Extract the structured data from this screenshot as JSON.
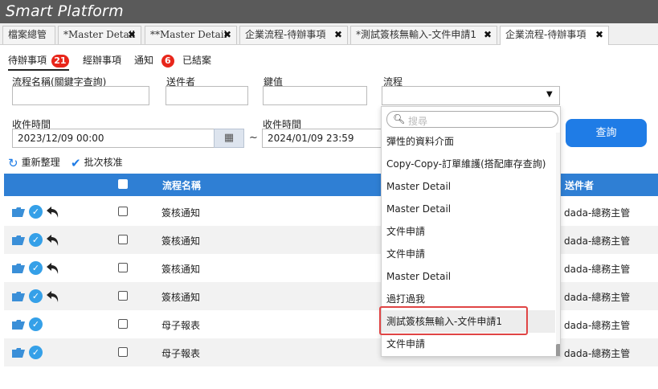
{
  "app": {
    "title": "Smart Platform"
  },
  "tabs": [
    {
      "label": "檔案總管",
      "closable": false
    },
    {
      "label": "*Master Detail",
      "closable": true
    },
    {
      "label": "**Master Detail",
      "closable": true
    },
    {
      "label": "企業流程-待辦事項",
      "closable": true
    },
    {
      "label": "*測試簽核無輸入-文件申請1",
      "closable": true
    },
    {
      "label": "企業流程-待辦事項",
      "closable": true,
      "active": true
    }
  ],
  "subtabs": {
    "todo": "待辦事項",
    "todo_count": "21",
    "handled": "經辦事項",
    "notice": "通知",
    "notice_count": "6",
    "closed": "已結案"
  },
  "form": {
    "flow_name_label": "流程名稱(關鍵字查詢)",
    "flow_name_value": "",
    "sender_label": "送件者",
    "sender_value": "",
    "key_label": "鍵值",
    "key_value": "",
    "flow_label": "流程",
    "flow_value": "",
    "recv_time_label": "收件時間",
    "recv_from": "2023/12/09 00:00",
    "recv_time_label2": "收件時間",
    "recv_to": "2024/01/09 23:59",
    "tilde": "~",
    "query_button": "查詢"
  },
  "actions": {
    "refresh": "重新整理",
    "batch_approve": "批次核准"
  },
  "table": {
    "headers": {
      "flow_name": "流程名稱",
      "sender": "送件者"
    },
    "rows": [
      {
        "flow_name": "簽核通知",
        "sender": "dada-總務主管",
        "undo": true
      },
      {
        "flow_name": "簽核通知",
        "sender": "dada-總務主管",
        "undo": true
      },
      {
        "flow_name": "簽核通知",
        "sender": "dada-總務主管",
        "undo": true
      },
      {
        "flow_name": "簽核通知",
        "sender": "dada-總務主管",
        "undo": true
      },
      {
        "flow_name": "母子報表",
        "sender": "dada-總務主管",
        "undo": false
      },
      {
        "flow_name": "母子報表",
        "sender": "dada-總務主管",
        "undo": false
      }
    ]
  },
  "dropdown": {
    "search_placeholder": "搜尋",
    "items": [
      "彈性的資料介面",
      "Copy-Copy-訂單維護(搭配庫存查詢)",
      "Master Detail",
      "Master Detail",
      "文件申請",
      "文件申請",
      "Master Detail",
      "過打過我",
      "測試簽核無輸入-文件申請1",
      "文件申請"
    ],
    "highlighted_index": 8
  },
  "colors": {
    "accent": "#1f7ce6",
    "header": "#2f7fd4",
    "badge": "#e8261b",
    "highlight_border": "#e04545"
  }
}
